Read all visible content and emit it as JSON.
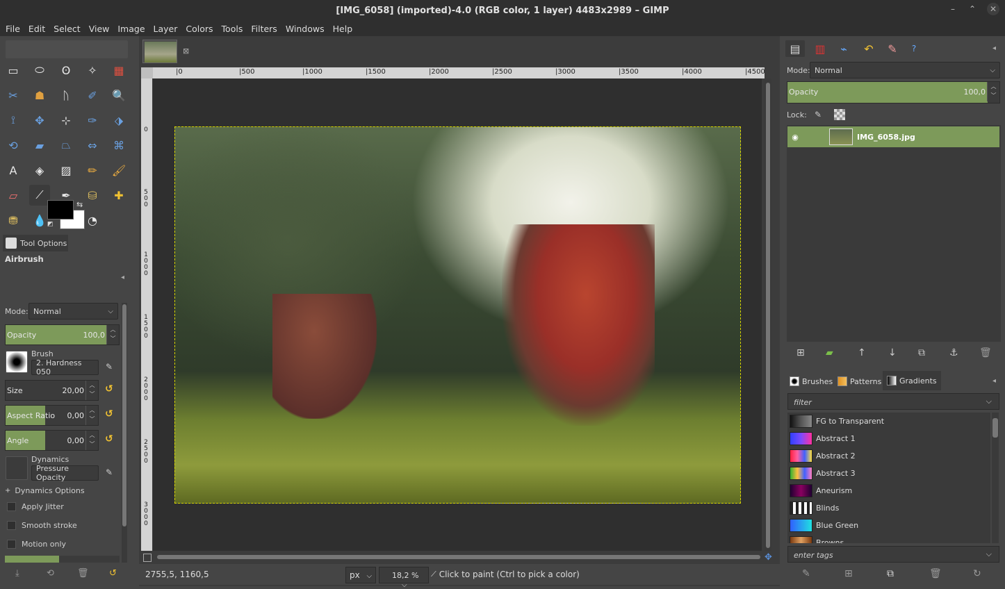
{
  "window": {
    "title": "[IMG_6058] (imported)-4.0 (RGB color, 1 layer) 4483x2989 – GIMP"
  },
  "menu": [
    "File",
    "Edit",
    "Select",
    "View",
    "Image",
    "Layer",
    "Colors",
    "Tools",
    "Filters",
    "Windows",
    "Help"
  ],
  "toolbox": {
    "tools": [
      "rect-select",
      "ellipse-select",
      "free-select",
      "fuzzy-select",
      "by-color-select",
      "scissors-select",
      "foreground-select",
      "paths",
      "color-picker",
      "zoom",
      "measure",
      "move",
      "alignment",
      "crop",
      "unified-transform",
      "rotate",
      "shear",
      "perspective",
      "flip",
      "cage-transform",
      "text",
      "bucket-fill",
      "gradient",
      "pencil",
      "paintbrush",
      "eraser",
      "airbrush",
      "ink",
      "clone",
      "heal",
      "perspective-clone",
      "blur-sharpen",
      "smudge",
      "dodge-burn"
    ],
    "fg_color": "#000000",
    "bg_color": "#ffffff"
  },
  "tool_options": {
    "tab_label": "Tool Options",
    "tool_name": "Airbrush",
    "mode_label": "Mode:",
    "mode_value": "Normal",
    "opacity_label": "Opacity",
    "opacity_value": "100,0",
    "brush_label": "Brush",
    "brush_value": "2. Hardness 050",
    "size_label": "Size",
    "size_value": "20,00",
    "aspect_label": "Aspect Ratio",
    "aspect_value": "0,00",
    "angle_label": "Angle",
    "angle_value": "0,00",
    "dynamics_label": "Dynamics",
    "dynamics_value": "Pressure Opacity",
    "dynamics_options": "Dynamics Options",
    "apply_jitter": "Apply Jitter",
    "smooth_stroke": "Smooth stroke",
    "motion_only": "Motion only"
  },
  "rulers": {
    "h": [
      "0",
      "500",
      "1000",
      "1500",
      "2000",
      "2500",
      "3000",
      "3500",
      "4000",
      "4500"
    ],
    "v": [
      "0",
      "500",
      "1000",
      "1500",
      "2000",
      "2500",
      "3000"
    ]
  },
  "status": {
    "coords": "2755,5, 1160,5",
    "unit": "px",
    "zoom": "18,2 %",
    "message": "Click to paint (Ctrl to pick a color)"
  },
  "layers": {
    "mode_label": "Mode:",
    "mode_value": "Normal",
    "opacity_label": "Opacity",
    "opacity_value": "100,0",
    "lock_label": "Lock:",
    "layer_name": "IMG_6058.jpg"
  },
  "resources": {
    "tabs": [
      "Brushes",
      "Patterns",
      "Gradients"
    ],
    "filter_placeholder": "filter",
    "gradients": [
      {
        "name": "FG to Transparent",
        "colors": "linear-gradient(90deg,#111,#555 50%,#888)"
      },
      {
        "name": "Abstract 1",
        "colors": "linear-gradient(90deg,#3040ff,#7a4bff,#ff30a0)"
      },
      {
        "name": "Abstract 2",
        "colors": "linear-gradient(90deg,#ff2040,#ff60a0,#4060ff,#ffe040)"
      },
      {
        "name": "Abstract 3",
        "colors": "linear-gradient(90deg,#30b030,#ffc040,#4060ff,#ff80c0)"
      },
      {
        "name": "Aneurism",
        "colors": "linear-gradient(90deg,#200030,#8a0060,#200030)"
      },
      {
        "name": "Blinds",
        "colors": "repeating-linear-gradient(90deg,#222 0 4px,#fff 4px 8px)"
      },
      {
        "name": "Blue Green",
        "colors": "linear-gradient(90deg,#3060ff,#20e0e0)"
      },
      {
        "name": "Browns",
        "colors": "linear-gradient(90deg,#7a3a10,#e0a060,#7a3a10)"
      }
    ],
    "tags_placeholder": "enter tags"
  }
}
